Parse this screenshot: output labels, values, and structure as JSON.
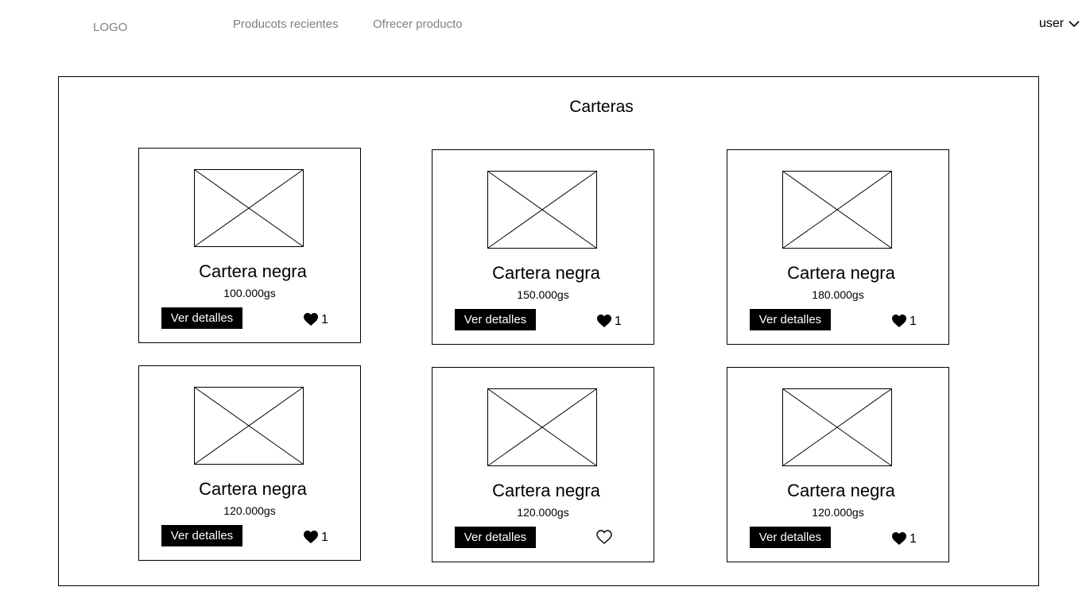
{
  "header": {
    "logo": "LOGO",
    "nav": [
      {
        "label": "Producots recientes"
      },
      {
        "label": "Ofrecer producto"
      }
    ],
    "user": {
      "label": "user",
      "icon": "chevron-down-icon"
    }
  },
  "main": {
    "title": "Carteras",
    "cards": [
      {
        "name": "Cartera negra",
        "price": "100.000gs",
        "button": "Ver detalles",
        "likes": "1",
        "liked": true
      },
      {
        "name": "Cartera negra",
        "price": "150.000gs",
        "button": "Ver detalles",
        "likes": "1",
        "liked": true
      },
      {
        "name": "Cartera negra",
        "price": "180.000gs",
        "button": "Ver detalles",
        "likes": "1",
        "liked": true
      },
      {
        "name": "Cartera negra",
        "price": "120.000gs",
        "button": "Ver detalles",
        "likes": "1",
        "liked": true
      },
      {
        "name": "Cartera negra",
        "price": "120.000gs",
        "button": "Ver detalles",
        "likes": "",
        "liked": false
      },
      {
        "name": "Cartera negra",
        "price": "120.000gs",
        "button": "Ver detalles",
        "likes": "1",
        "liked": true
      }
    ]
  }
}
